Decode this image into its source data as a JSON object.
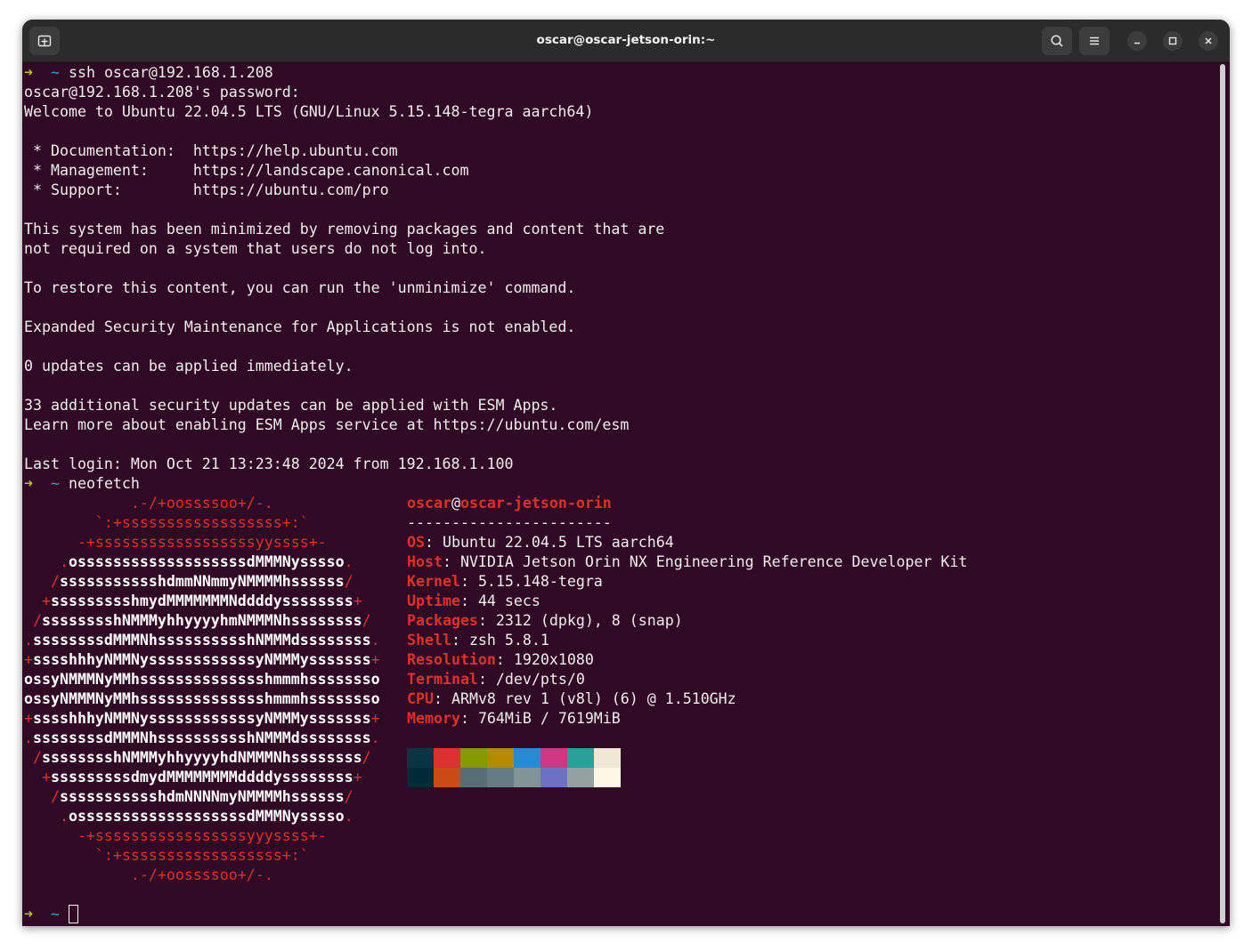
{
  "window": {
    "title": "oscar@oscar-jetson-orin:~",
    "buttons": [
      "new-tab-icon",
      "search-icon",
      "hamburger-menu-icon",
      "minimize-icon",
      "maximize-icon",
      "close-icon"
    ]
  },
  "prompt": {
    "arrow": "➜",
    "dir": "~"
  },
  "session": {
    "command1": "ssh oscar@192.168.1.208",
    "motd": [
      "oscar@192.168.1.208's password:",
      "Welcome to Ubuntu 22.04.5 LTS (GNU/Linux 5.15.148-tegra aarch64)",
      "",
      " * Documentation:  https://help.ubuntu.com",
      " * Management:     https://landscape.canonical.com",
      " * Support:        https://ubuntu.com/pro",
      "",
      "This system has been minimized by removing packages and content that are",
      "not required on a system that users do not log into.",
      "",
      "To restore this content, you can run the 'unminimize' command.",
      "",
      "Expanded Security Maintenance for Applications is not enabled.",
      "",
      "0 updates can be applied immediately.",
      "",
      "33 additional security updates can be applied with ESM Apps.",
      "Learn more about enabling ESM Apps service at https://ubuntu.com/esm",
      "",
      "Last login: Mon Oct 21 13:23:48 2024 from 192.168.1.100"
    ],
    "command2": "neofetch"
  },
  "neofetch": {
    "logo": [
      "            .-/+oossssoo+/-.",
      "        `:+ssssssssssssssssss+:`",
      "      -+ssssssssssssssssssyyssss+-",
      "    .osssssssssssssssssssdMMMNysssso.",
      "   /ssssssssssshdmmNNmmyNMMMMhssssss/",
      "  +ssssssssshmydMMMMMMMNddddyssssssss+",
      " /sssssssshNMMMyhhyyyyhmNMMMNhssssssss/",
      ".ssssssssdMMMNhsssssssssshNMMMdssssssss.",
      "+sssshhhyNMMNyssssssssssssyNMMMysssssss+",
      "ossyNMMMNyMMhsssssssssssssshmmmhssssssso",
      "ossyNMMMNyMMhsssssssssssssshmmmhssssssso",
      "+sssshhhyNMMNyssssssssssssyNMMMysssssss+",
      ".ssssssssdMMMNhsssssssssshNMMMdssssssss.",
      " /sssssssshNMMMyhhyyyyhdNMMMNhssssssss/",
      "  +sssssssssdmydMMMMMMMMddddyssssssss+",
      "   /ssssssssssshdmNNNNmyNMMMMhssssss/",
      "    .osssssssssssssssssssdMMMNysssso.",
      "      -+sssssssssssssssssyyyssss+-",
      "        `:+ssssssssssssssssss+:`",
      "            .-/+oossssoo+/-."
    ],
    "user": "oscar",
    "at": "@",
    "host": "oscar-jetson-orin",
    "separator": "-----------------------",
    "fields": [
      {
        "key": "OS",
        "value": "Ubuntu 22.04.5 LTS aarch64"
      },
      {
        "key": "Host",
        "value": "NVIDIA Jetson Orin NX Engineering Reference Developer Kit"
      },
      {
        "key": "Kernel",
        "value": "5.15.148-tegra"
      },
      {
        "key": "Uptime",
        "value": "44 secs"
      },
      {
        "key": "Packages",
        "value": "2312 (dpkg), 8 (snap)"
      },
      {
        "key": "Shell",
        "value": "zsh 5.8.1"
      },
      {
        "key": "Resolution",
        "value": "1920x1080"
      },
      {
        "key": "Terminal",
        "value": "/dev/pts/0"
      },
      {
        "key": "CPU",
        "value": "ARMv8 rev 1 (v8l) (6) @ 1.510GHz"
      },
      {
        "key": "Memory",
        "value": "764MiB / 7619MiB"
      }
    ],
    "palette": [
      [
        "#073642",
        "#dc322f",
        "#859900",
        "#b58900",
        "#268bd2",
        "#d33682",
        "#2aa198",
        "#eee8d5"
      ],
      [
        "#002b36",
        "#cb4b16",
        "#586e75",
        "#657b83",
        "#839496",
        "#6c71c4",
        "#93a1a1",
        "#fdf6e3"
      ]
    ]
  },
  "colors": {
    "terminal_bg": "#300a24",
    "accent_red": "#e0302a",
    "prompt_arrow": "#b5c42e",
    "prompt_dir": "#34a0c8"
  }
}
